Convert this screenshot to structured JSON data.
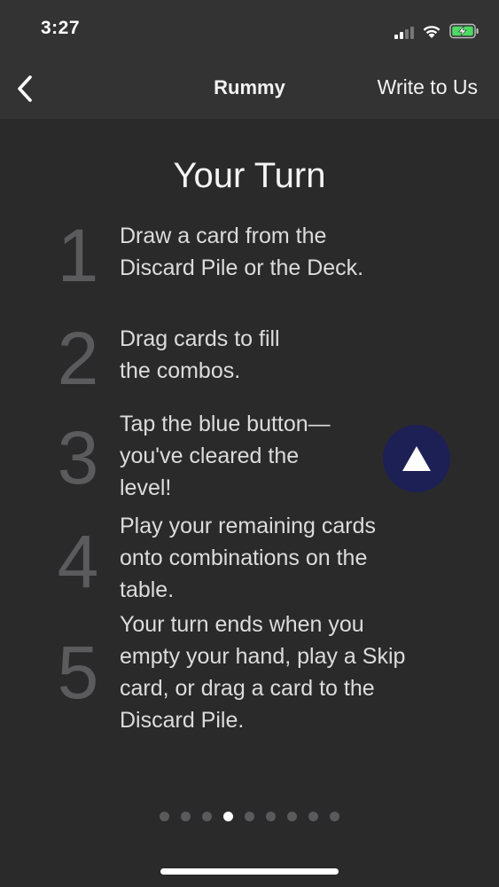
{
  "status_bar": {
    "time": "3:27",
    "icons": [
      "signal-icon",
      "wifi-icon",
      "battery-charging-icon"
    ]
  },
  "nav": {
    "back_icon": "chevron-left-icon",
    "title": "Rummy",
    "action_label": "Write to Us"
  },
  "page": {
    "title": "Your Turn",
    "steps": [
      {
        "number": "1",
        "text": "Draw a card from the\nDiscard Pile or the Deck."
      },
      {
        "number": "2",
        "text": "Drag cards to fill\nthe combos."
      },
      {
        "number": "3",
        "text": "Tap the blue button—\nyou've cleared the\nlevel!"
      },
      {
        "number": "4",
        "text": "Play your remaining cards\nonto combinations on the\ntable."
      },
      {
        "number": "5",
        "text": "Your turn ends when you\nempty your hand, play a Skip\ncard, or drag a card to the\nDiscard Pile."
      }
    ],
    "blue_button_icon": "triangle-up-icon"
  },
  "pagination": {
    "total": 9,
    "active_index": 3
  },
  "colors": {
    "background": "#2a2a2b",
    "bar": "#333334",
    "step_number": "#5b5b5d",
    "blue_button": "#1d2055",
    "battery_green": "#4cd964"
  }
}
